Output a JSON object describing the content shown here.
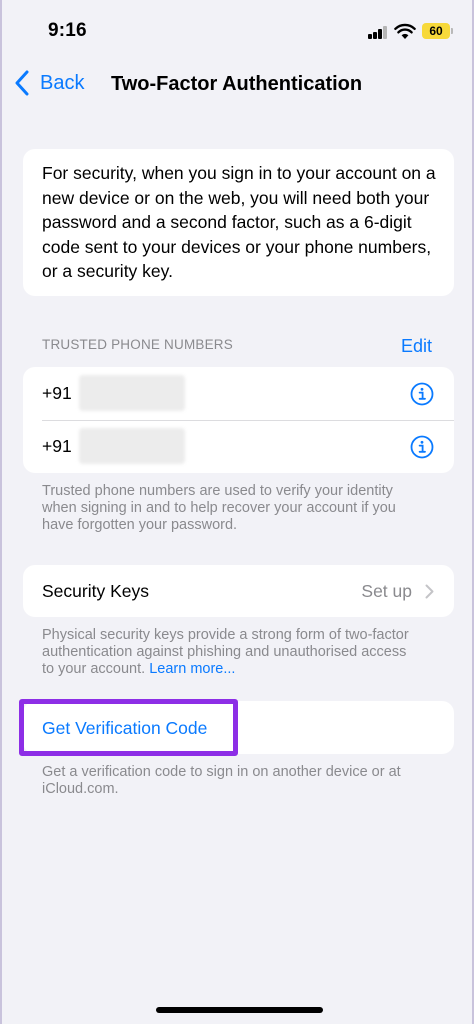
{
  "status_bar": {
    "time": "9:16",
    "battery": "60",
    "battery_color": "#f7d93a",
    "icons": [
      "signal-icon",
      "wifi-icon",
      "battery-icon"
    ]
  },
  "nav": {
    "back_label": "Back",
    "title": "Two-Factor Authentication"
  },
  "intro": {
    "text": "For security, when you sign in to your account on a new device or on the web, you will need both your password and a second factor, such as a 6-digit code sent to your devices or your phone numbers, or a security key."
  },
  "trusted_numbers": {
    "header": "TRUSTED PHONE NUMBERS",
    "edit_label": "Edit",
    "numbers": [
      {
        "prefix": "+91"
      },
      {
        "prefix": "+91"
      }
    ],
    "footnote": "Trusted phone numbers are used to verify your identity when signing in and to help recover your account if you have forgotten your password."
  },
  "security_keys": {
    "label": "Security Keys",
    "value": "Set up",
    "footnote": "Physical security keys provide a strong form of two-factor authentication against phishing and unauthorised access to your account.",
    "learn_more": "Learn more..."
  },
  "verification": {
    "label": "Get Verification Code",
    "footnote": "Get a verification code to sign in on another device or at iCloud.com."
  },
  "colors": {
    "accent": "#0a7aff",
    "highlight": "#8d2ee6",
    "background": "#f2f2f7"
  }
}
